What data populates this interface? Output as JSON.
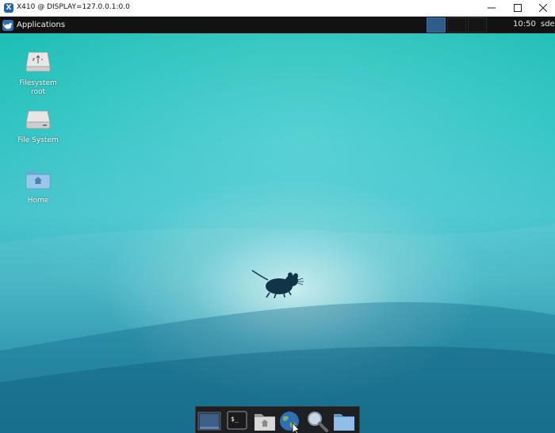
{
  "window": {
    "title": "X410 @ DISPLAY=127.0.0.1:0.0",
    "app_icon": "x410-icon",
    "controls": [
      "minimize",
      "maximize",
      "close"
    ]
  },
  "panel": {
    "applications_label": "Applications",
    "applications_icon": "xfce-mouse-icon",
    "workspaces": [
      {
        "name": "workspace-1",
        "active": true
      },
      {
        "name": "workspace-2",
        "active": false
      },
      {
        "name": "workspace-3",
        "active": false
      }
    ],
    "clock": "10:50",
    "user": "sde"
  },
  "desktop": {
    "icons": [
      {
        "label_line1": "Filesystem",
        "label_line2": "root",
        "icon": "usb-drive-icon"
      },
      {
        "label": "File System",
        "icon": "hard-drive-icon"
      },
      {
        "label": "Home",
        "icon": "home-folder-icon"
      }
    ],
    "wallpaper_logo": "xfce-mouse-logo",
    "colors": {
      "teal": "#2cc3c0",
      "deep": "#1b7f9c",
      "panel": "#121212",
      "accent": "#2f5c8c"
    }
  },
  "dock": {
    "items": [
      {
        "name": "show-desktop",
        "icon": "desktop-icon"
      },
      {
        "name": "terminal",
        "icon": "terminal-icon"
      },
      {
        "name": "file-manager",
        "icon": "home-folder-icon"
      },
      {
        "name": "web-browser",
        "icon": "globe-icon"
      },
      {
        "name": "app-finder",
        "icon": "magnifier-icon"
      },
      {
        "name": "folder",
        "icon": "folder-icon"
      }
    ]
  }
}
